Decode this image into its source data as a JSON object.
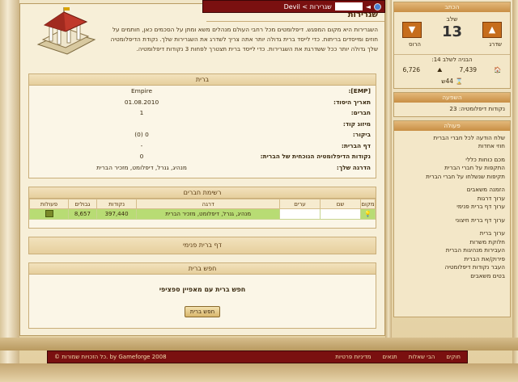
{
  "topbar": {
    "breadcrumbs": "שגרירות > Devil"
  },
  "page": {
    "title": "שגרירות",
    "intro": "השגרירות היא מקום המפגש. דיפלומטים מכל רחבי העולם מנהלים משא ומתן על הסכמים כאן, חותמים על חוזים ומייסדים בריתות. כדי לייסד ברית גדולה יותר אתה צריך לשדרג את השגרירות שלך. נקודת הדיפלומטיה שלך גדולה יותר ככל ששדרגת את השגרירות. כדי לייסד ברית תצטרך לפחות 3 נקודות דיפלומטיה."
  },
  "alliance": {
    "header": "ברית",
    "rows": [
      {
        "label": "[EMP]:",
        "value": "Empire"
      },
      {
        "label": "תאריך היסוד:",
        "value": "01.08.2010"
      },
      {
        "label": "חברים:",
        "value": "1"
      },
      {
        "label": "מיזוג קוד:",
        "value": ""
      },
      {
        "label": "ביקור:",
        "value": "0 (0)"
      },
      {
        "label": "דף הברית:",
        "value": "-"
      },
      {
        "label": "נקודות הדיפלומטיה הנוכחית של הברית:",
        "value": "0"
      },
      {
        "label": "הדרגה שלך:",
        "value": "מנהיג, גנרל, דיפלומט, מזכיר הברית"
      }
    ]
  },
  "members": {
    "header": "רשימת חברים",
    "columns": [
      "מקום",
      "שם",
      "ערים",
      "דרגה",
      "נקודות",
      "גבולים",
      "פעולות"
    ],
    "rows": [
      {
        "place": "",
        "name": "",
        "cities": "",
        "rank": "מנהיג, גנרל, דיפלומט, מזכיר הברית",
        "points": "397,440",
        "borders": "8,657",
        "actions": ""
      }
    ]
  },
  "internal_page": {
    "header": "דף ברית פנימי"
  },
  "search": {
    "header": "חפש ברית",
    "text": "חפש ברית עם מאפיין ספציפי",
    "button": "חפש ברית"
  },
  "sidebar": {
    "city_header": "הכתב",
    "tier_label": "שלב",
    "tier_value": "13",
    "down_label": "הרוס",
    "up_label": "שדרג",
    "next_label": "הבניה לשלב 14:",
    "res1": "7,439",
    "res2": "6,726",
    "time": "44ש",
    "influence_header": "השפעה",
    "diplomacy_points": "נקודות דיפלומטיה: 23",
    "actions_header": "פעולה",
    "actions": [
      "שלח הודעה לכל חברי הברית",
      "חוזי אחדות",
      "",
      "מכם כוחות כללי",
      "התקפות על חברי הברית",
      "תקיפות שנשלחו על חברי הברית",
      "",
      "הזמנה משאבים",
      "ערוך דרגות",
      "ערוך דף ברית פנימי",
      "",
      "ערוך דף ברית חיצוני",
      "",
      "ערוך ברית",
      "חלוקת משרות",
      "העבירות מנהיגות הברית",
      "פירוק/את הברית",
      "העבר נקודות דיפלומטיה",
      "בטים משאבים"
    ]
  },
  "bottombar": {
    "copyright": "© כל הזכויות שמורות. by Gameforge 2008",
    "links": [
      "מדיניות פרטיות",
      "תנאים",
      "הבי שאלות",
      "חוקים"
    ]
  }
}
